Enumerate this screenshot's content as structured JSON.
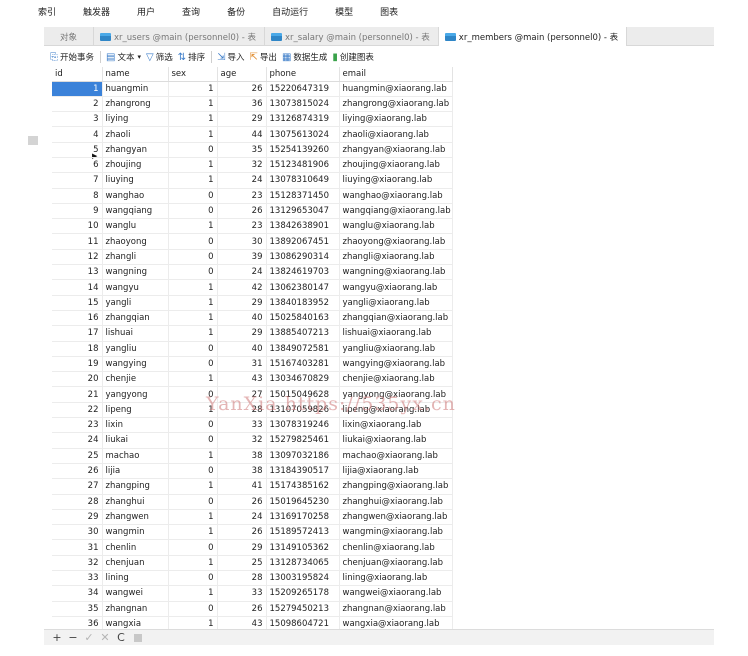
{
  "menu": [
    "索引",
    "触发器",
    "用户",
    "查询",
    "备份",
    "自动运行",
    "模型",
    "图表"
  ],
  "tabs": [
    {
      "label": "对象"
    },
    {
      "label": "xr_users @main (personnel0) - 表"
    },
    {
      "label": "xr_salary @main (personnel0) - 表"
    },
    {
      "label": "xr_members @main (personnel0) - 表"
    }
  ],
  "toolbar": {
    "begin": "开始事务",
    "text": "文本",
    "filter": "筛选",
    "sort": "排序",
    "import": "导入",
    "export": "导出",
    "datagen": "数据生成",
    "chart": "创建图表"
  },
  "columns": [
    "id",
    "name",
    "sex",
    "age",
    "phone",
    "email"
  ],
  "rows": [
    [
      "1",
      "huangmin",
      "1",
      "26",
      "15220647319",
      "huangmin@xiaorang.lab"
    ],
    [
      "2",
      "zhangrong",
      "1",
      "36",
      "13073815024",
      "zhangrong@xiaorang.lab"
    ],
    [
      "3",
      "liying",
      "1",
      "29",
      "13126874319",
      "liying@xiaorang.lab"
    ],
    [
      "4",
      "zhaoli",
      "1",
      "44",
      "13075613024",
      "zhaoli@xiaorang.lab"
    ],
    [
      "5",
      "zhangyan",
      "0",
      "35",
      "15254139260",
      "zhangyan@xiaorang.lab"
    ],
    [
      "6",
      "zhoujing",
      "1",
      "32",
      "15123481906",
      "zhoujing@xiaorang.lab"
    ],
    [
      "7",
      "liuying",
      "1",
      "24",
      "13078310649",
      "liuying@xiaorang.lab"
    ],
    [
      "8",
      "wanghao",
      "0",
      "23",
      "15128371450",
      "wanghao@xiaorang.lab"
    ],
    [
      "9",
      "wangqiang",
      "0",
      "26",
      "13129653047",
      "wangqiang@xiaorang.lab"
    ],
    [
      "10",
      "wanglu",
      "1",
      "23",
      "13842638901",
      "wanglu@xiaorang.lab"
    ],
    [
      "11",
      "zhaoyong",
      "0",
      "30",
      "13892067451",
      "zhaoyong@xiaorang.lab"
    ],
    [
      "12",
      "zhangli",
      "0",
      "39",
      "13086290314",
      "zhangli@xiaorang.lab"
    ],
    [
      "13",
      "wangning",
      "0",
      "24",
      "13824619703",
      "wangning@xiaorang.lab"
    ],
    [
      "14",
      "wangyu",
      "1",
      "42",
      "13062380147",
      "wangyu@xiaorang.lab"
    ],
    [
      "15",
      "yangli",
      "1",
      "29",
      "13840183952",
      "yangli@xiaorang.lab"
    ],
    [
      "16",
      "zhangqian",
      "1",
      "40",
      "15025840163",
      "zhangqian@xiaorang.lab"
    ],
    [
      "17",
      "lishuai",
      "1",
      "29",
      "13885407213",
      "lishuai@xiaorang.lab"
    ],
    [
      "18",
      "yangliu",
      "0",
      "40",
      "13849072581",
      "yangliu@xiaorang.lab"
    ],
    [
      "19",
      "wangying",
      "0",
      "31",
      "15167403281",
      "wangying@xiaorang.lab"
    ],
    [
      "20",
      "chenjie",
      "1",
      "43",
      "13034670829",
      "chenjie@xiaorang.lab"
    ],
    [
      "21",
      "yangyong",
      "0",
      "27",
      "15015049628",
      "yangyong@xiaorang.lab"
    ],
    [
      "22",
      "lipeng",
      "1",
      "28",
      "13107059826",
      "lipeng@xiaorang.lab"
    ],
    [
      "23",
      "lixin",
      "0",
      "33",
      "13078319246",
      "lixin@xiaorang.lab"
    ],
    [
      "24",
      "liukai",
      "0",
      "32",
      "15279825461",
      "liukai@xiaorang.lab"
    ],
    [
      "25",
      "machao",
      "1",
      "38",
      "13097032186",
      "machao@xiaorang.lab"
    ],
    [
      "26",
      "lijia",
      "0",
      "38",
      "13184390517",
      "lijia@xiaorang.lab"
    ],
    [
      "27",
      "zhangping",
      "1",
      "41",
      "15174385162",
      "zhangping@xiaorang.lab"
    ],
    [
      "28",
      "zhanghui",
      "0",
      "26",
      "15019645230",
      "zhanghui@xiaorang.lab"
    ],
    [
      "29",
      "zhangwen",
      "1",
      "24",
      "13169170258",
      "zhangwen@xiaorang.lab"
    ],
    [
      "30",
      "wangmin",
      "1",
      "26",
      "15189572413",
      "wangmin@xiaorang.lab"
    ],
    [
      "31",
      "chenlin",
      "0",
      "29",
      "13149105362",
      "chenlin@xiaorang.lab"
    ],
    [
      "32",
      "chenjuan",
      "1",
      "25",
      "13128734065",
      "chenjuan@xiaorang.lab"
    ],
    [
      "33",
      "lining",
      "0",
      "28",
      "13003195824",
      "lining@xiaorang.lab"
    ],
    [
      "34",
      "wangwei",
      "1",
      "33",
      "15209265178",
      "wangwei@xiaorang.lab"
    ],
    [
      "35",
      "zhangnan",
      "0",
      "26",
      "15279450213",
      "zhangnan@xiaorang.lab"
    ],
    [
      "36",
      "wangxia",
      "1",
      "43",
      "15098604721",
      "wangxia@xiaorang.lab"
    ]
  ],
  "watermark": "YanXia https://535yx.cn",
  "footer": {
    "add": "+",
    "remove": "−",
    "apply": "✓",
    "discard": "✕",
    "refresh": "C"
  },
  "colors": {
    "selection": "#3b82d9",
    "tab_bg": "#ececec",
    "watermark": "#cd7878"
  }
}
